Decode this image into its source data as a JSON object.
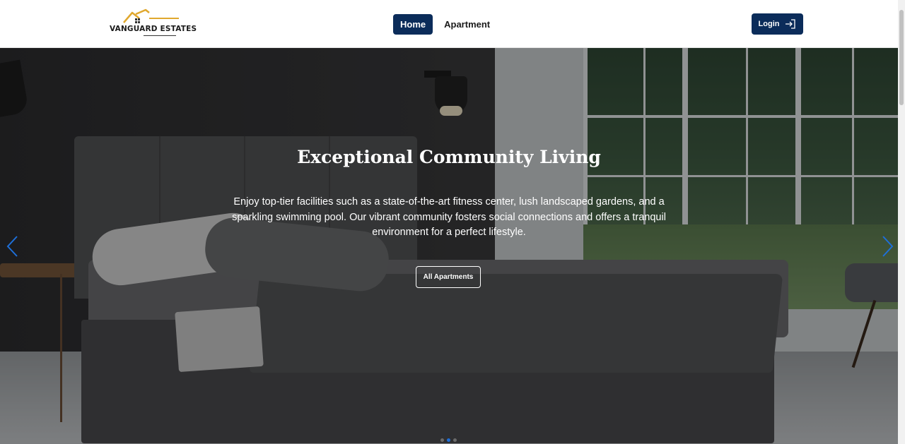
{
  "brand": {
    "name": "VANGUARD ESTATES"
  },
  "nav": {
    "items": [
      "Home",
      "Apartment"
    ],
    "active": "Home"
  },
  "login": {
    "label": "Login",
    "icon": "login-arrow-icon"
  },
  "hero": {
    "title": "Exceptional Community Living",
    "description": "Enjoy top-tier facilities such as a state-of-the-art fitness center, lush landscaped gardens, and a sparkling swimming pool. Our vibrant community fosters social connections and offers a tranquil environment for a perfect lifestyle.",
    "button_label": "All Apartments",
    "slides": 3,
    "active_slide": 2
  },
  "colors": {
    "primary": "#0b2c5a",
    "accent": "#e0a82e",
    "dot_active": "#1e6fd9"
  }
}
